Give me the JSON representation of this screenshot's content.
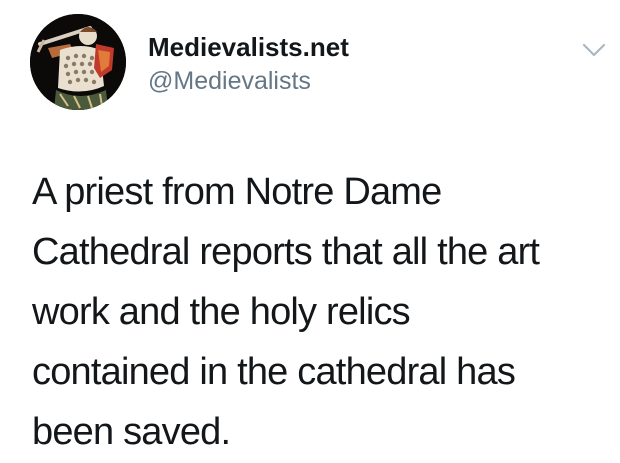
{
  "account": {
    "display_name": "Medievalists.net",
    "handle": "@Medievalists",
    "avatar_icon": "medieval-warrior-avatar"
  },
  "menu": {
    "icon": "chevron-down-icon"
  },
  "tweet": {
    "lines": [
      "A priest from Notre Dame",
      "Cathedral reports that all the art",
      "work and the holy relics",
      "contained in the cathedral has",
      "been saved."
    ]
  },
  "colors": {
    "text": "#14171a",
    "secondary": "#657786",
    "chevron": "#aab8c2",
    "background": "#ffffff"
  }
}
